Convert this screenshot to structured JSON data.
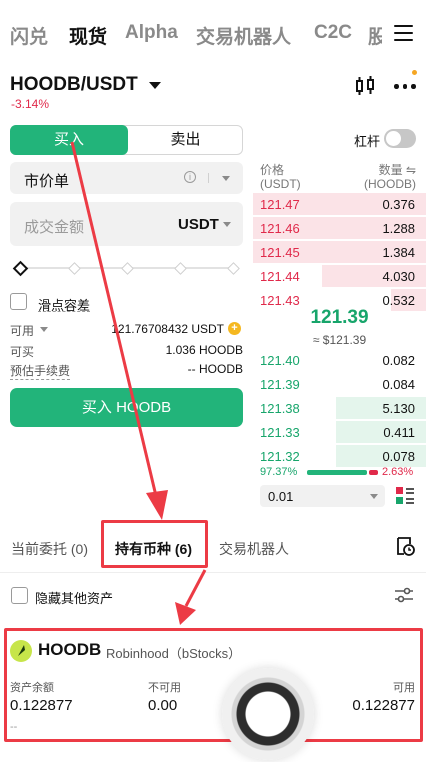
{
  "nav": {
    "tabs": [
      "闪兑",
      "现货",
      "Alpha",
      "交易机器人",
      "C2C",
      "股"
    ],
    "active": "现货"
  },
  "pair": {
    "symbol": "HOODB/USDT",
    "change": "-3.14%"
  },
  "trade": {
    "buy_tab": "买入",
    "sell_tab": "卖出",
    "leverage_label": "杠杆",
    "order_type": "市价单",
    "amount_placeholder": "成交金额",
    "amount_unit": "USDT",
    "slippage_label": "滑点容差",
    "available_label": "可用",
    "available_value": "121.76708432 USDT",
    "can_buy_label": "可买",
    "can_buy_value": "1.036 HOODB",
    "fee_label": "预估手续费",
    "fee_value": "-- HOODB",
    "buy_button": "买入 HOODB"
  },
  "orderbook": {
    "price_header": "价格",
    "price_unit": "(USDT)",
    "qty_header": "数量",
    "qty_unit": "(HOODB)",
    "asks": [
      {
        "price": "121.47",
        "qty": "0.376",
        "depth": 1.0
      },
      {
        "price": "121.46",
        "qty": "1.288",
        "depth": 1.0
      },
      {
        "price": "121.45",
        "qty": "1.384",
        "depth": 1.0
      },
      {
        "price": "121.44",
        "qty": "4.030",
        "depth": 0.6
      },
      {
        "price": "121.43",
        "qty": "0.532",
        "depth": 0.2
      }
    ],
    "mid_price": "121.39",
    "mid_sub": "≈ $121.39",
    "bids": [
      {
        "price": "121.40",
        "qty": "0.082",
        "depth": 0.0
      },
      {
        "price": "121.39",
        "qty": "0.084",
        "depth": 0.0
      },
      {
        "price": "121.38",
        "qty": "5.130",
        "depth": 0.52
      },
      {
        "price": "121.33",
        "qty": "0.411",
        "depth": 0.52
      },
      {
        "price": "121.32",
        "qty": "0.078",
        "depth": 0.52
      }
    ],
    "buy_ratio": "97.37%",
    "sell_ratio": "2.63%",
    "precision": "0.01",
    "colors": {
      "ask": "#e0294a",
      "bid": "#17a56b"
    }
  },
  "bottom": {
    "tabs": [
      "当前委托 (0)",
      "持有币种 (6)",
      "交易机器人"
    ],
    "active": "持有币种 (6)",
    "hide_other": "隐藏其他资产"
  },
  "holding": {
    "name": "HOODB",
    "sub": "Robinhood（bStocks）",
    "balance_label": "资产余额",
    "balance_value": "0.122877",
    "frozen_label": "不可用",
    "frozen_value": "0.00",
    "available_label": "可用",
    "available_value": "0.122877",
    "extra": "--"
  }
}
